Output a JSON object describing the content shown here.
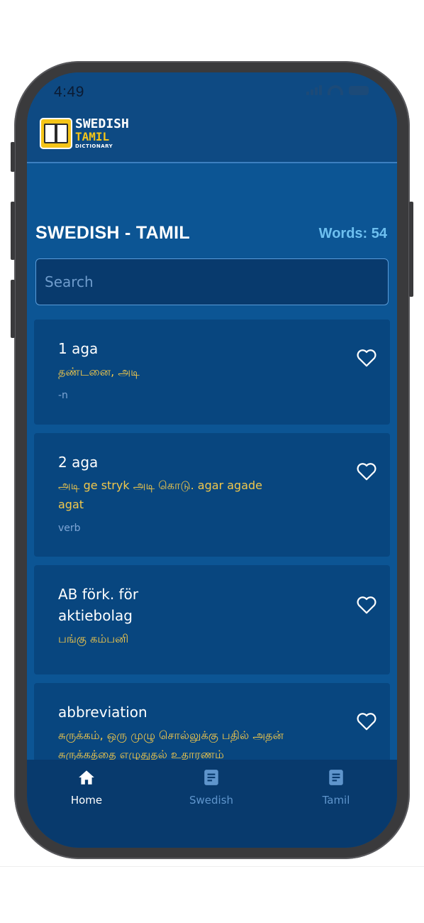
{
  "status": {
    "time": "4:49"
  },
  "logo": {
    "line1": "SWEDISH",
    "line2": "TAMIL",
    "line3": "DICTIONARY"
  },
  "header": {
    "title": "SWEDISH - TAMIL",
    "word_count": "Words: 54"
  },
  "search": {
    "placeholder": "Search"
  },
  "entries": [
    {
      "headword": "1 aga",
      "translation": "தண்டனை, அடி",
      "pos": "-n"
    },
    {
      "headword": "2 aga",
      "translation": "அடி ge stryk அடி கொடு. agar agade agat",
      "pos": "verb"
    },
    {
      "headword": "AB förk. för aktiebolag",
      "translation": "பங்கு கம்பனி",
      "pos": ""
    },
    {
      "headword": "abbreviation",
      "translation": "சுருக்கம், ஒரு முழு சொல்லுக்கு பதில் அதன் சுருக்கத்தை எழுதுதல் உதாரணம்",
      "pos": ""
    }
  ],
  "nav": [
    {
      "label": "Home",
      "icon": "home-icon",
      "active": true
    },
    {
      "label": "Swedish",
      "icon": "document-icon",
      "active": false
    },
    {
      "label": "Tamil",
      "icon": "document-icon",
      "active": false
    }
  ],
  "colors": {
    "screen_bg": "#0c5594",
    "card_bg": "#08467f",
    "accent_yellow": "#f2c84b",
    "count_blue": "#6ec0f0"
  }
}
